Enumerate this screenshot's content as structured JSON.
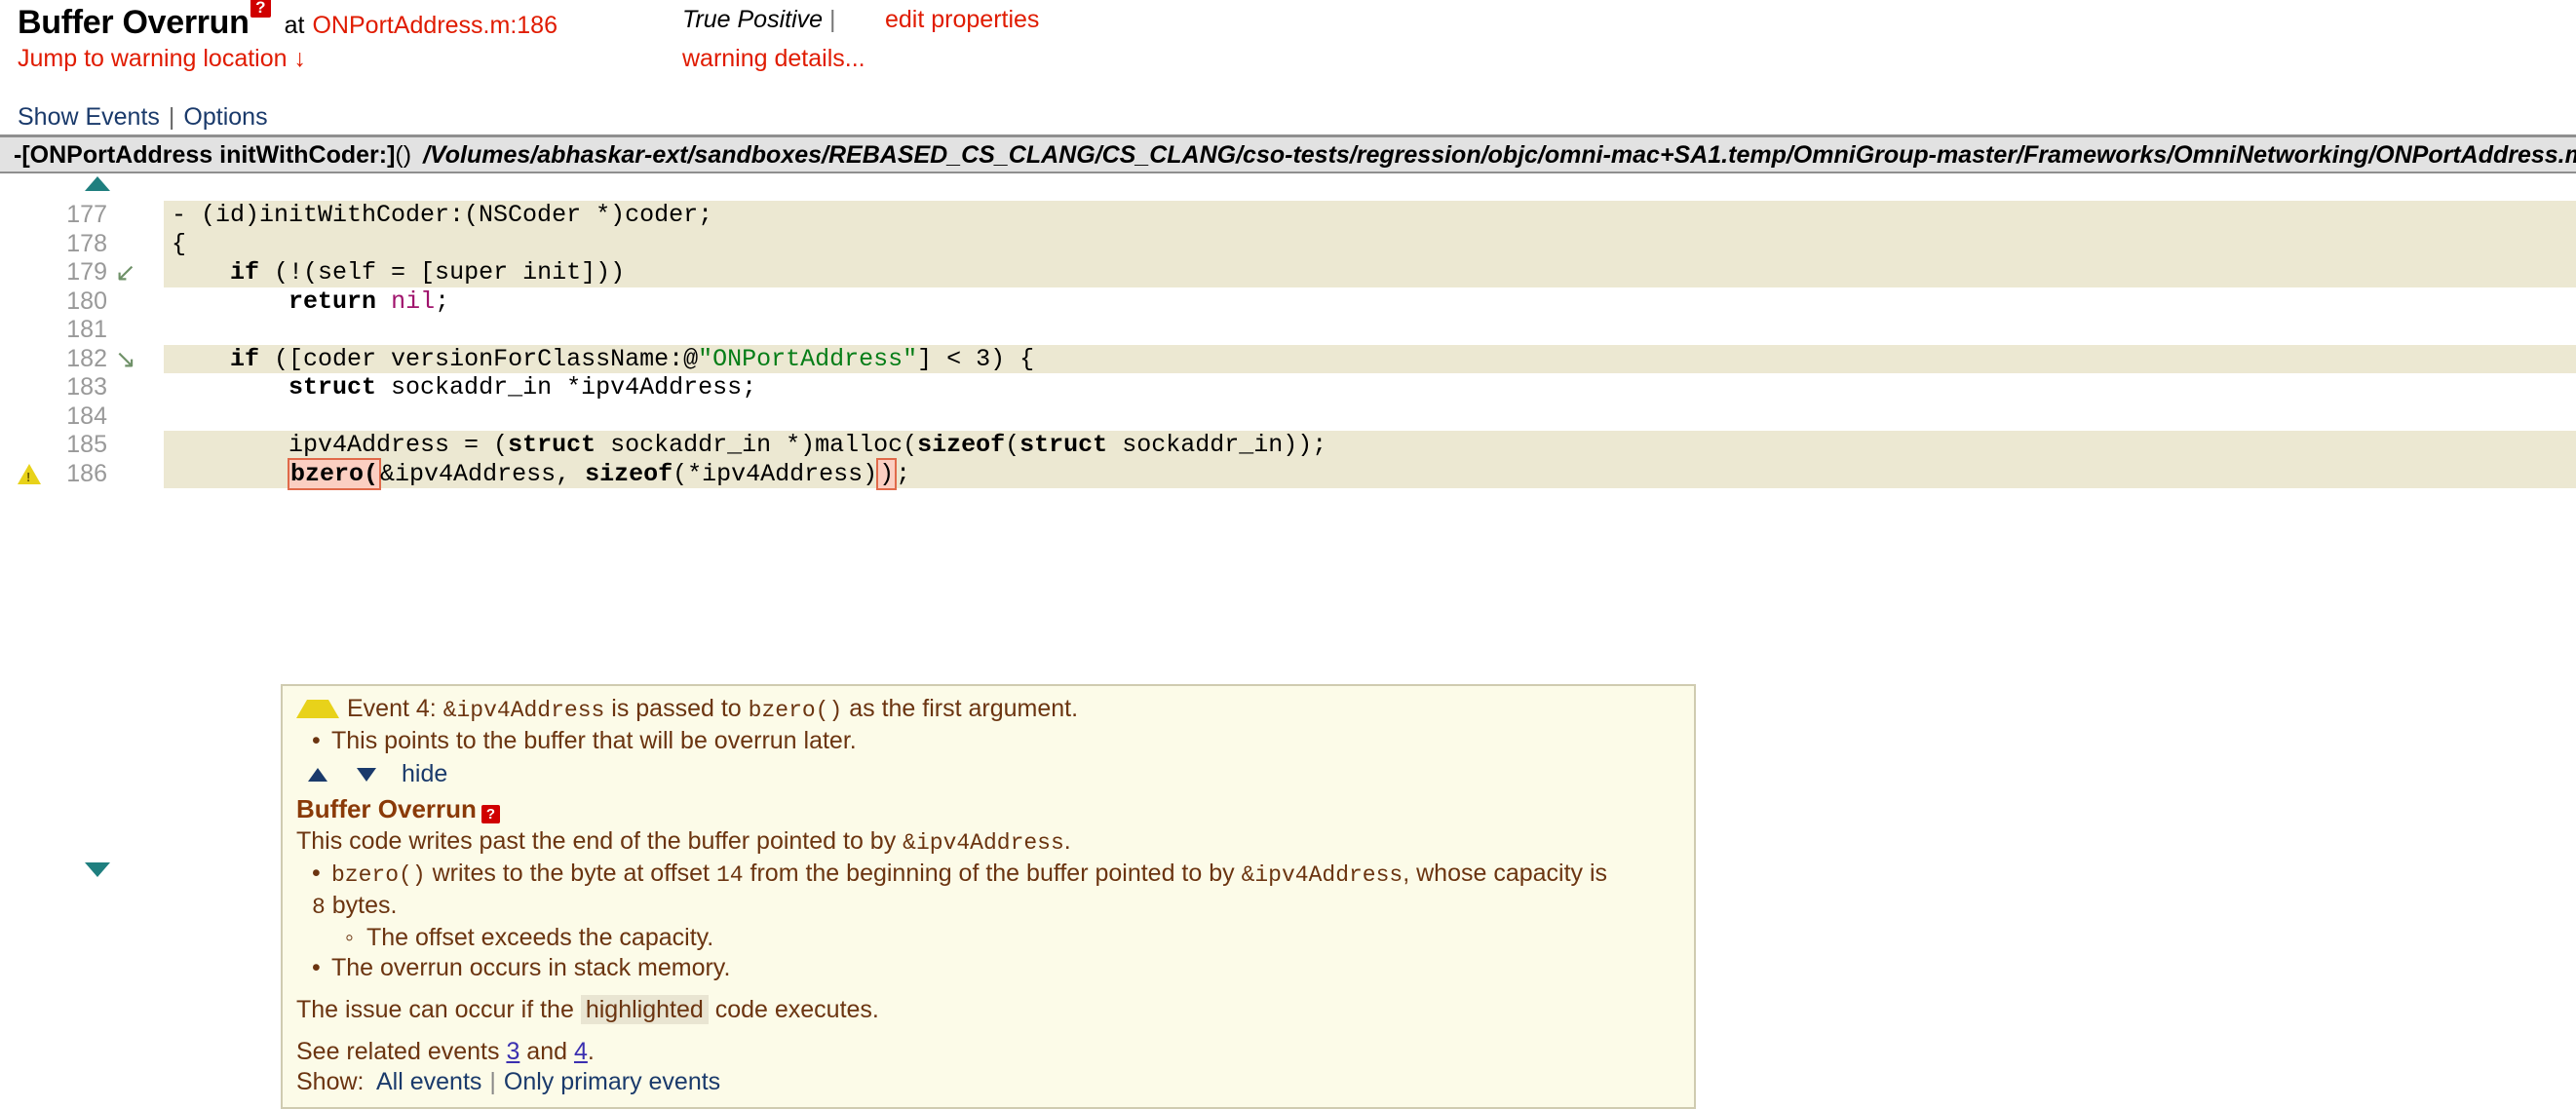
{
  "header": {
    "warning_title": "Buffer Overrun",
    "help_badge": "?",
    "at_label": "at",
    "location": "ONPortAddress.m:186",
    "verdict": "True Positive",
    "separator": "|",
    "edit_properties": "edit properties",
    "jump_link": "Jump to warning location ↓",
    "warning_details": "warning details..."
  },
  "toolbar": {
    "show_events": "Show Events",
    "separator": "|",
    "options": "Options"
  },
  "filebar": {
    "function_name": "-[ONPortAddress initWithCoder:]",
    "parens": "()",
    "path": "/Volumes/abhaskar-ext/sandboxes/REBASED_CS_CLANG/CS_CLANG/cso-tests/regression/objc/omni-mac+SA1.temp/OmniGroup-master/Frameworks/OmniNetworking/ONPortAddress.m"
  },
  "code": {
    "scroll_up_icon": "triangle-up",
    "scroll_down_icon": "triangle-down",
    "lines": [
      {
        "no": "177",
        "highlight": true,
        "marker": "",
        "flag": ""
      },
      {
        "no": "178",
        "highlight": true,
        "marker": "",
        "flag": ""
      },
      {
        "no": "179",
        "highlight": true,
        "marker": "branch-down-left",
        "flag": ""
      },
      {
        "no": "180",
        "highlight": false,
        "marker": "",
        "flag": ""
      },
      {
        "no": "181",
        "highlight": false,
        "marker": "",
        "flag": ""
      },
      {
        "no": "182",
        "highlight": true,
        "marker": "branch-down-right",
        "flag": ""
      },
      {
        "no": "183",
        "highlight": false,
        "marker": "",
        "flag": ""
      },
      {
        "no": "184",
        "highlight": false,
        "marker": "",
        "flag": ""
      },
      {
        "no": "185",
        "highlight": true,
        "marker": "",
        "flag": ""
      },
      {
        "no": "186",
        "highlight": true,
        "marker": "",
        "flag": "warning-triangle"
      }
    ],
    "text": {
      "l177": "- (id)initWithCoder:(NSCoder *)coder;",
      "l178": "{",
      "l179_a": "    ",
      "l179_kw": "if",
      "l179_b": " (!(self = [super init]))",
      "l180_a": "        ",
      "l180_kw": "return",
      "l180_b": " ",
      "l180_nil": "nil",
      "l180_c": ";",
      "l181": "",
      "l182_a": "    ",
      "l182_kw": "if",
      "l182_b": " ([coder versionForClassName:@",
      "l182_str": "\"ONPortAddress\"",
      "l182_c": "] < 3) {",
      "l183_a": "        ",
      "l183_kw": "struct",
      "l183_b": " sockaddr_in *ipv4Address;",
      "l184": "",
      "l185_a": "        ipv4Address = (",
      "l185_kw1": "struct",
      "l185_b": " sockaddr_in *)malloc(",
      "l185_kw2": "sizeof",
      "l185_c": "(",
      "l185_kw3": "struct",
      "l185_d": " sockaddr_in));",
      "l186_indent": "        ",
      "l186_hl1": "bzero(",
      "l186_mid": "&ipv4Address, ",
      "l186_kw": "sizeof",
      "l186_mid2": "(*ipv4Address)",
      "l186_hl2": ")",
      "l186_tail": ";"
    }
  },
  "event": {
    "icon": "warning-triangle",
    "title_prefix": "Event 4:",
    "title_var": "&ipv4Address",
    "title_mid": "is passed to",
    "title_fn": "bzero()",
    "title_suffix": "as the first argument.",
    "bullet1": "This points to the buffer that will be overrun later.",
    "nav_up_icon": "triangle-up",
    "nav_down_icon": "triangle-down",
    "hide_label": "hide",
    "detail_title": "Buffer Overrun",
    "detail_badge": "?",
    "detail_line1_a": "This code writes past the end of the buffer pointed to by",
    "detail_line1_var": "&ipv4Address",
    "detail_line1_b": ".",
    "detail_bullet_fn": "bzero()",
    "detail_bullet_a": "writes to the byte at offset",
    "detail_bullet_offset": "14",
    "detail_bullet_b": "from the beginning of the buffer pointed to by",
    "detail_bullet_var": "&ipv4Address",
    "detail_bullet_c": ", whose capacity is",
    "detail_bullet_cap": "8",
    "detail_bullet_d": "bytes.",
    "detail_sub_bullet": "The offset exceeds the capacity.",
    "detail_bullet2": "The overrun occurs in stack memory.",
    "issue_a": "The issue can occur if the",
    "issue_hl": "highlighted",
    "issue_b": "code executes.",
    "related_a": "See related events",
    "related_1": "3",
    "related_and": "and",
    "related_2": "4",
    "related_b": ".",
    "show_label": "Show:",
    "show_all": "All events",
    "show_sep": "|",
    "show_primary": "Only primary events"
  },
  "colors": {
    "red_link": "#e01b00",
    "blue_link": "#1a3a6b",
    "code_highlight": "#ece8d2",
    "event_bg": "#fcfbe8",
    "event_text": "#6b3410",
    "warn_yellow": "#e8d21a",
    "badge_red": "#d00000",
    "teal": "#1f7f7f"
  }
}
